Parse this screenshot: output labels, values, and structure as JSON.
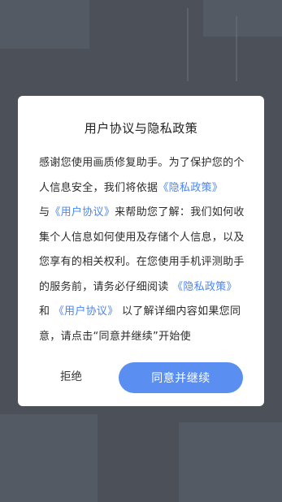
{
  "dialog": {
    "title": "用户协议与隐私政策",
    "body": {
      "p1": "感谢您使用画质修复助手。为了保护您的个人信息安全，我们将依据",
      "link_privacy_1": "《隐私政策》",
      "p2": "与",
      "link_user_1": "《用户协议》",
      "p3": "来帮助您了解：我们如何收集个人信息如何使用及存储个人信息，以及您享有的相关权利。在您使用手机评测助手的服务前，请务必仔细阅读 ",
      "link_privacy_2": "《隐私政策》",
      "p4": " 和 ",
      "link_user_2": "《用户协议》",
      "p5": " 以了解详细内容如果您同意，请点击“同意并继续”开始使"
    },
    "reject_label": "拒绝",
    "agree_label": "同意并继续"
  },
  "colors": {
    "overlay": "#4b5059",
    "link": "#4a86f2",
    "primary_button": "#5b8ef1"
  }
}
